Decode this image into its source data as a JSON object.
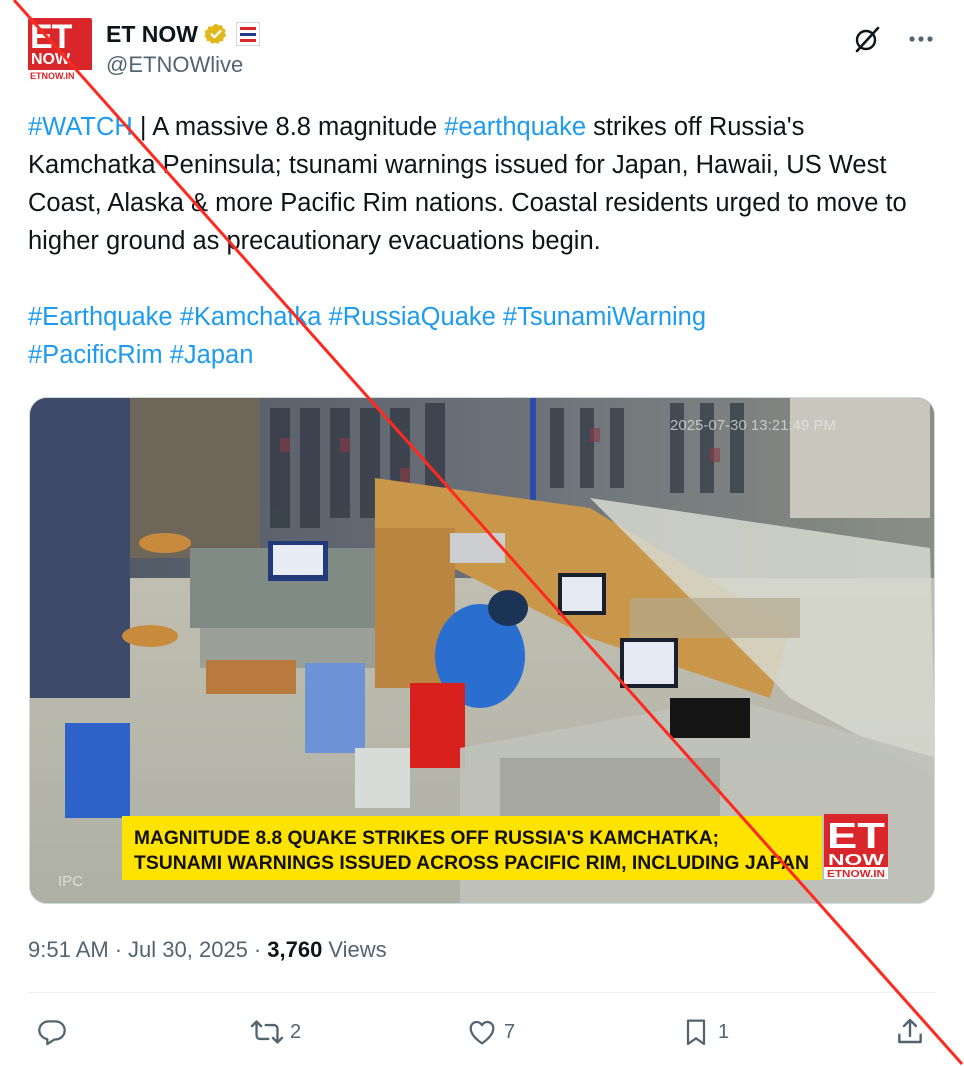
{
  "account": {
    "avatar_et": "ET",
    "avatar_now": "NOW",
    "avatar_site": "ETNOW.IN",
    "display_name": "ET NOW",
    "handle": "@ETNOWlive"
  },
  "header_icons": [
    "grok-icon",
    "more-icon"
  ],
  "tweet": {
    "text_parts": [
      {
        "text": "#WATCH",
        "tag": true
      },
      {
        "text": " | A massive 8.8 magnitude ",
        "tag": false
      },
      {
        "text": "#earthquake",
        "tag": true
      },
      {
        "text": " strikes off Russia's Kamchatka Peninsula; tsunami warnings issued for Japan, Hawaii, US West Coast, Alaska & more Pacific Rim nations. Coastal residents urged to move to higher ground as precautionary evacuations begin.",
        "tag": false
      }
    ],
    "hashtags": [
      "#Earthquake",
      "#Kamchatka",
      "#RussiaQuake",
      "#TsunamiWarning",
      "#PacificRim",
      "#Japan"
    ]
  },
  "media": {
    "cctv_timestamp": "2025-07-30 13:21:49 PM",
    "camera_label": "IPC",
    "ticker_line1": "MAGNITUDE 8.8 QUAKE STRIKES OFF RUSSIA'S KAMCHATKA;",
    "ticker_line2": "TSUNAMI WARNINGS ISSUED ACROSS PACIFIC RIM, INCLUDING JAPAN",
    "logo_et": "ET",
    "logo_now": "NOW",
    "logo_site": "ETNOW.IN"
  },
  "meta": {
    "time": "9:51 AM",
    "separator": "·",
    "date": "Jul 30, 2025",
    "views_count": "3,760",
    "views_label": "Views"
  },
  "actions": {
    "replies": "",
    "reposts": "2",
    "likes": "7",
    "bookmarks": "1"
  },
  "colors": {
    "link": "#1d9bf0",
    "secondary": "#536471",
    "brand_red": "#d8262b",
    "ticker_yellow": "#ffe300",
    "strike_red": "#ff2a1f"
  }
}
